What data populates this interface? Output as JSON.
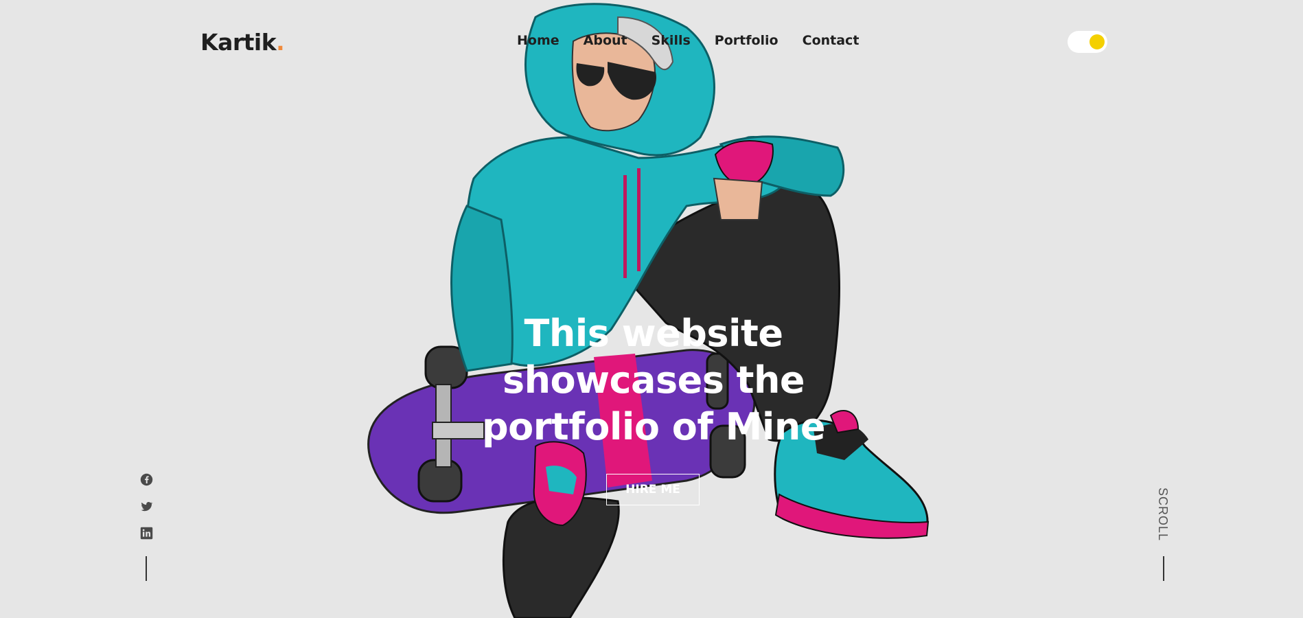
{
  "header": {
    "logo_text": "Kartik",
    "logo_dot": ".",
    "nav": [
      {
        "label": "Home"
      },
      {
        "label": "About"
      },
      {
        "label": "Skills"
      },
      {
        "label": "Portfolio"
      },
      {
        "label": "Contact"
      }
    ],
    "theme_toggle_icon": "sun-toggle-icon"
  },
  "hero": {
    "headline": "This website showcases the portfolio of Mine",
    "cta_label": "HIRE ME",
    "illustration_icon": "skater-illustration"
  },
  "social": {
    "icons": [
      "facebook-icon",
      "twitter-icon",
      "linkedin-icon"
    ]
  },
  "scroll": {
    "label": "SCROLL"
  },
  "colors": {
    "background": "#e6e6e6",
    "accent_dot": "#f08a3c",
    "toggle_knob": "#f4d000",
    "hoodie": "#1fb6bf",
    "skateboard": "#6a32b5",
    "pink": "#e0177a"
  }
}
